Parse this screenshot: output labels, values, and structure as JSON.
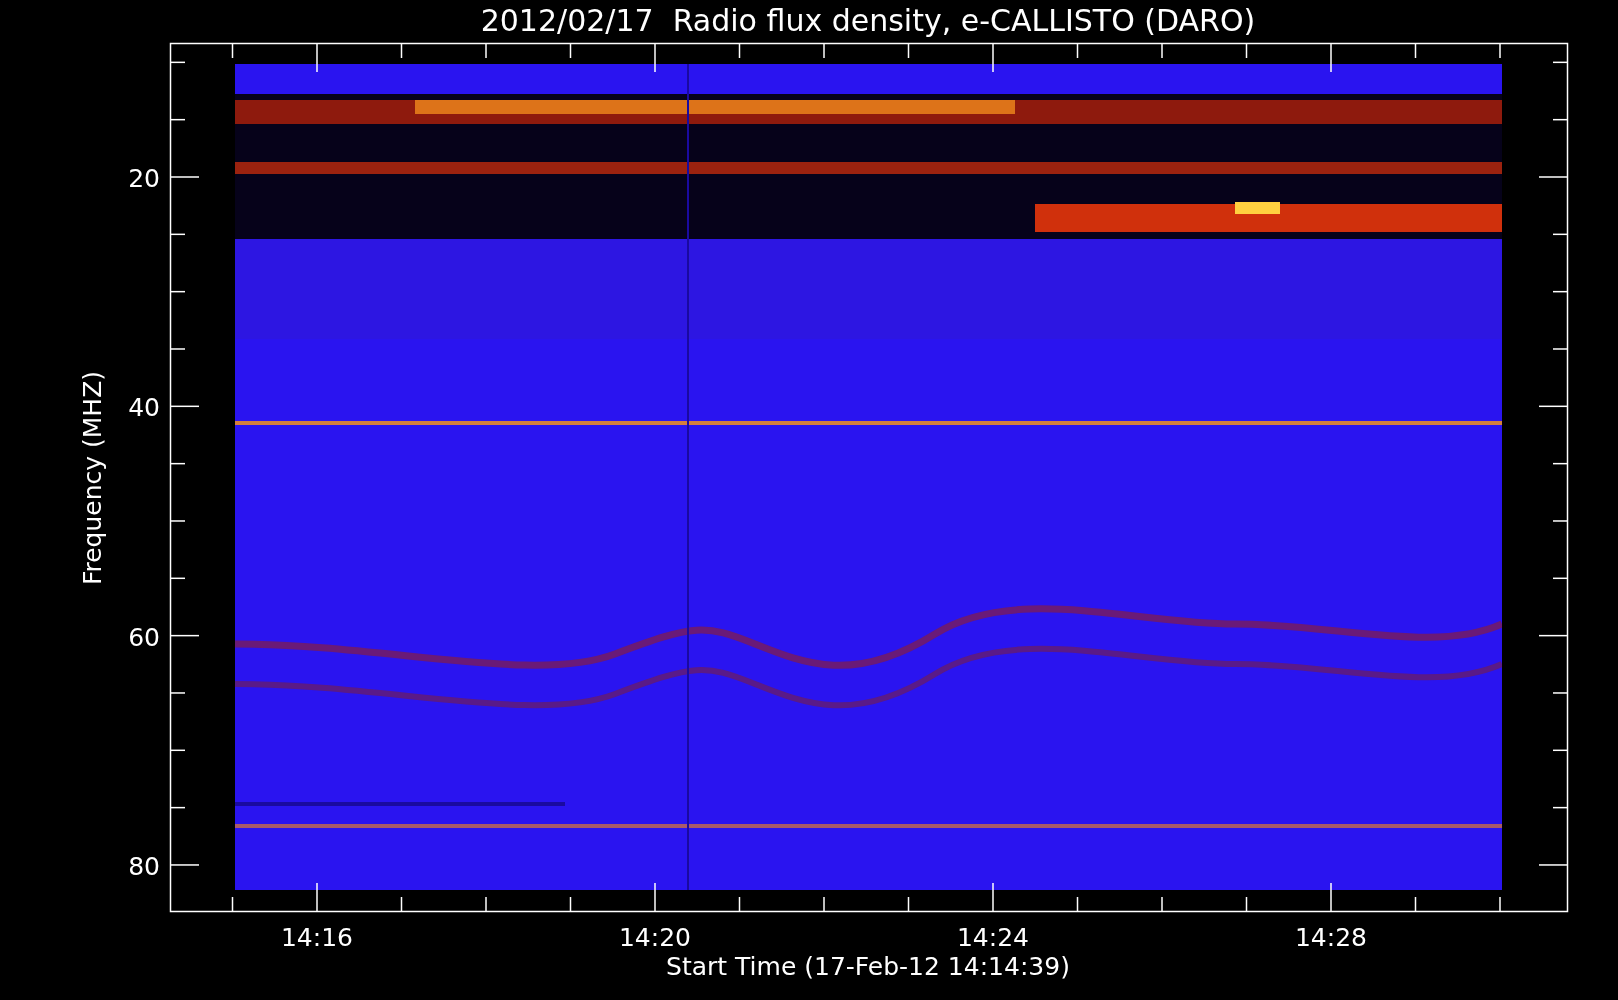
{
  "title": "2012/02/17  Radio flux density, e-CALLISTO (DARO)",
  "plot": {
    "ylabel": "Frequency (MHZ)",
    "xlabel": "Start Time (17-Feb-12 14:14:39)",
    "yticks": [
      "20",
      "40",
      "60",
      "80"
    ],
    "xticks": [
      "14:16",
      "14:20",
      "14:24",
      "14:28"
    ]
  }
}
